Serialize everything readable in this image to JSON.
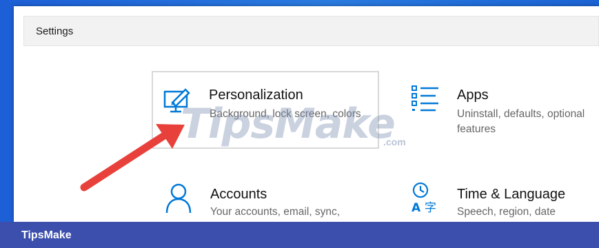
{
  "window": {
    "title": "Settings"
  },
  "tiles": [
    {
      "name": "Personalization",
      "desc": "Background, lock screen, colors",
      "icon": "personalization-icon"
    },
    {
      "name": "Apps",
      "desc": "Uninstall, defaults, optional features",
      "icon": "apps-icon"
    },
    {
      "name": "Accounts",
      "desc": "Your accounts, email, sync,",
      "icon": "accounts-icon"
    },
    {
      "name": "Time & Language",
      "desc": "Speech, region, date",
      "icon": "time-language-icon"
    }
  ],
  "watermark": {
    "text": "TipsMake",
    "suffix": ".com"
  },
  "footer": {
    "label": "TipsMake"
  },
  "colors": {
    "accent": "#0078d7",
    "arrow": "#e8413b",
    "footer": "#3d4fad"
  }
}
